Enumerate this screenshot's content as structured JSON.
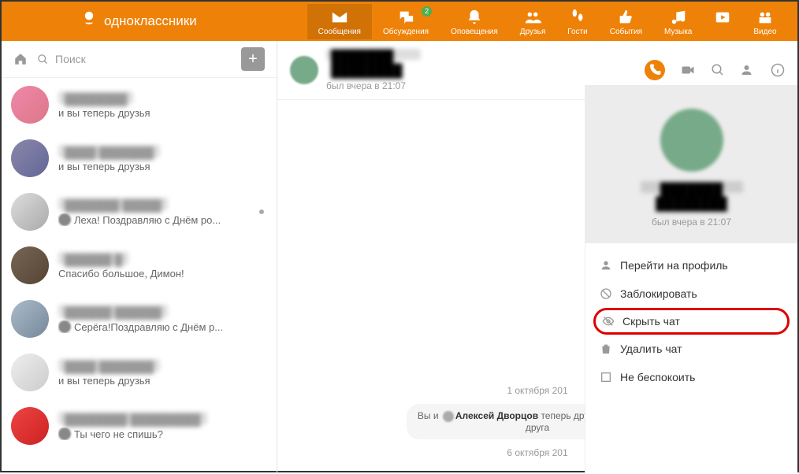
{
  "brand": "одноклассники",
  "nav": {
    "messages": "Сообщения",
    "discussions": "Обсуждения",
    "discussions_badge": "2",
    "notifications": "Оповещения",
    "friends": "Друзья",
    "guests": "Гости",
    "events": "События",
    "music": "Музыка",
    "video": "Видео"
  },
  "search_placeholder": "Поиск",
  "chats": [
    {
      "name": "████████",
      "preview": "и вы теперь друзья"
    },
    {
      "name": "████ ███████",
      "preview": "и вы теперь друзья"
    },
    {
      "name": "███████ █████",
      "preview": "Леха! Поздравляю с Днём ро...",
      "icon": true,
      "dot": true
    },
    {
      "name": "██████ █",
      "preview": "Спасибо большое, Димон!"
    },
    {
      "name": "██████ ██████",
      "preview": "Серёга!Поздравляю с Днём р...",
      "icon": true
    },
    {
      "name": "████ ███████",
      "preview": "и вы теперь друзья"
    },
    {
      "name": "████████ █████████",
      "preview": "Ты чего не спишь?",
      "icon": true
    }
  ],
  "chat_header": {
    "name": "███████ ████████",
    "status": "был вчера в 21:07"
  },
  "chat_body": {
    "date1": "1 октября 201",
    "system_msg_pre": "Вы и ",
    "system_msg_name": "Алексей Дворцов",
    "system_msg_post": " теперь друзья на Однокла",
    "system_msg_line2": "друга",
    "date2": "6 октября 201"
  },
  "info_panel": {
    "name": "███████ ████████",
    "status": "был вчера в 21:07",
    "actions": {
      "profile": "Перейти на профиль",
      "block": "Заблокировать",
      "hide": "Скрыть чат",
      "delete": "Удалить чат",
      "dnd": "Не беспокоить"
    }
  }
}
